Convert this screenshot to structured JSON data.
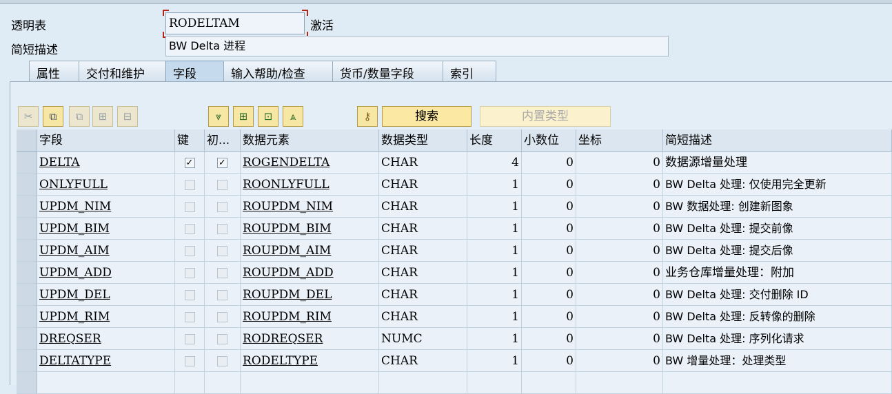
{
  "header": {
    "table_label": "透明表",
    "table_name": "RODELTAM",
    "status": "激活",
    "desc_label": "简短描述",
    "description": "BW Delta 进程"
  },
  "tabs": [
    "属性",
    "交付和维护",
    "字段",
    "输入帮助/检查",
    "货币/数量字段",
    "索引"
  ],
  "active_tab": "字段",
  "toolbar": {
    "icons": [
      "cut-icon",
      "copy-icon",
      "paste-icon",
      "insert-row-icon",
      "delete-row-icon",
      "move-down-icon",
      "insert-structure-icon",
      "append-icon",
      "move-up-icon",
      "key-icon"
    ],
    "search_label": "搜索",
    "builtin_type_label": "内置类型"
  },
  "grid": {
    "columns": [
      "字段",
      "键",
      "初...",
      "数据元素",
      "数据类型",
      "长度",
      "小数位",
      "坐标",
      "简短描述"
    ],
    "rows": [
      {
        "field": "DELTA",
        "key": true,
        "initial": true,
        "element": "ROGENDELTA",
        "type": "CHAR",
        "length": "4",
        "decimals": "0",
        "coord": "0",
        "desc": "数据源增量处理"
      },
      {
        "field": "ONLYFULL",
        "key": false,
        "initial": false,
        "element": "ROONLYFULL",
        "type": "CHAR",
        "length": "1",
        "decimals": "0",
        "coord": "0",
        "desc": "BW Delta 处理: 仅使用完全更新"
      },
      {
        "field": "UPDM_NIM",
        "key": false,
        "initial": false,
        "element": "ROUPDM_NIM",
        "type": "CHAR",
        "length": "1",
        "decimals": "0",
        "coord": "0",
        "desc": "BW 数据处理: 创建新图象"
      },
      {
        "field": "UPDM_BIM",
        "key": false,
        "initial": false,
        "element": "ROUPDM_BIM",
        "type": "CHAR",
        "length": "1",
        "decimals": "0",
        "coord": "0",
        "desc": "BW Delta 处理: 提交前像"
      },
      {
        "field": "UPDM_AIM",
        "key": false,
        "initial": false,
        "element": "ROUPDM_AIM",
        "type": "CHAR",
        "length": "1",
        "decimals": "0",
        "coord": "0",
        "desc": "BW Delta 处理: 提交后像"
      },
      {
        "field": "UPDM_ADD",
        "key": false,
        "initial": false,
        "element": "ROUPDM_ADD",
        "type": "CHAR",
        "length": "1",
        "decimals": "0",
        "coord": "0",
        "desc": "业务仓库增量处理：附加"
      },
      {
        "field": "UPDM_DEL",
        "key": false,
        "initial": false,
        "element": "ROUPDM_DEL",
        "type": "CHAR",
        "length": "1",
        "decimals": "0",
        "coord": "0",
        "desc": "BW Delta 处理: 交付删除 ID"
      },
      {
        "field": "UPDM_RIM",
        "key": false,
        "initial": false,
        "element": "ROUPDM_RIM",
        "type": "CHAR",
        "length": "1",
        "decimals": "0",
        "coord": "0",
        "desc": "BW Delta 处理: 反转像的删除"
      },
      {
        "field": "DREQSER",
        "key": false,
        "initial": false,
        "element": "RODREQSER",
        "type": "NUMC",
        "length": "1",
        "decimals": "0",
        "coord": "0",
        "desc": "BW Delta 处理: 序列化请求"
      },
      {
        "field": "DELTATYPE",
        "key": false,
        "initial": false,
        "element": "RODELTYPE",
        "type": "CHAR",
        "length": "1",
        "decimals": "0",
        "coord": "0",
        "desc": "BW 增量处理：处理类型"
      },
      {
        "field": "",
        "key": null,
        "initial": null,
        "element": "",
        "type": "",
        "length": "",
        "decimals": "",
        "coord": "",
        "desc": ""
      }
    ]
  }
}
